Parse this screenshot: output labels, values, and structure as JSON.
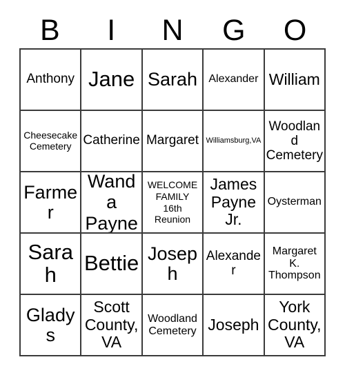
{
  "card": {
    "header_letters": [
      "B",
      "I",
      "N",
      "G",
      "O"
    ],
    "columns": 5,
    "rows": 5,
    "grid_border_color": "#3a3a3a",
    "background_color": "#ffffff",
    "text_color": "#000000",
    "free_space_index": 12,
    "cells": [
      {
        "text": "Anthony",
        "size": "md"
      },
      {
        "text": "Jane",
        "size": "xxl"
      },
      {
        "text": "Sarah",
        "size": "xl"
      },
      {
        "text": "Alexander",
        "size": "sm"
      },
      {
        "text": "William",
        "size": "lg"
      },
      {
        "text": "Cheesecake\nCemetery",
        "size": "xs"
      },
      {
        "text": "Catherine",
        "size": "md"
      },
      {
        "text": "Margaret",
        "size": "md"
      },
      {
        "text": "Williamsburg,VA",
        "size": "xxs"
      },
      {
        "text": "Woodland\nCemetery",
        "size": "md"
      },
      {
        "text": "Farmer",
        "size": "xl"
      },
      {
        "text": "Wanda\nPayne",
        "size": "xl"
      },
      {
        "text": "WELCOME\nFAMILY\n16th\nReunion",
        "size": "xs"
      },
      {
        "text": "James\nPayne\nJr.",
        "size": "lg"
      },
      {
        "text": "Oysterman",
        "size": "sm"
      },
      {
        "text": "Sarah",
        "size": "xxl"
      },
      {
        "text": "Bettie",
        "size": "xxl"
      },
      {
        "text": "Joseph",
        "size": "xl"
      },
      {
        "text": "Alexander",
        "size": "md"
      },
      {
        "text": "Margaret\nK.\nThompson",
        "size": "sm"
      },
      {
        "text": "Gladys",
        "size": "xl"
      },
      {
        "text": "Scott\nCounty,\nVA",
        "size": "lg"
      },
      {
        "text": "Woodland\nCemetery",
        "size": "sm"
      },
      {
        "text": "Joseph",
        "size": "lg"
      },
      {
        "text": "York\nCounty,\nVA",
        "size": "lg"
      }
    ]
  }
}
